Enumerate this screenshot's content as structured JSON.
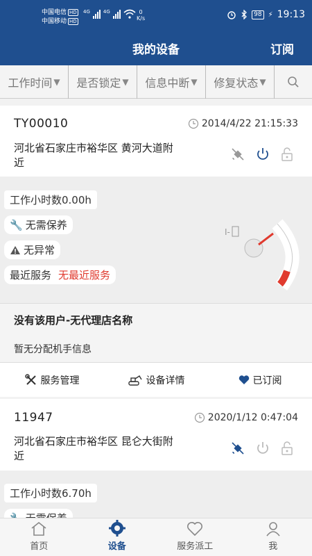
{
  "status": {
    "carrier1": "中国电信",
    "carrier2": "中国移动",
    "hd": "HD",
    "net": "4G",
    "speed_value": "0",
    "speed_unit": "K/s",
    "battery": "98",
    "time": "19:13"
  },
  "header": {
    "title": "我的设备",
    "subscribe": "订阅"
  },
  "filters": [
    "工作时间",
    "是否锁定",
    "信息中断",
    "修复状态"
  ],
  "devices": [
    {
      "id": "TY00010",
      "time": "2014/4/22 21:15:33",
      "address": "河北省石家庄市裕华区 黄河大道附近",
      "hours": "工作小时数0.00h",
      "maintenance": "无需保养",
      "anomaly": "无异常",
      "service_label": "最近服务",
      "service_value": "无最近服务",
      "dealer": "没有该用户-无代理店名称",
      "manager": "暂无分配机手信息"
    },
    {
      "id": "11947",
      "time": "2020/1/12 0:47:04",
      "address": "河北省石家庄市裕华区 昆仑大街附近",
      "hours": "工作小时数6.70h",
      "maintenance": "无需保养"
    }
  ],
  "actions": {
    "service": "服务管理",
    "detail": "设备详情",
    "subscribed": "已订阅"
  },
  "tabs": [
    "首页",
    "设备",
    "服务派工",
    "我"
  ],
  "colors": {
    "brand": "#1f4f8f",
    "alert": "#e03a2e"
  }
}
